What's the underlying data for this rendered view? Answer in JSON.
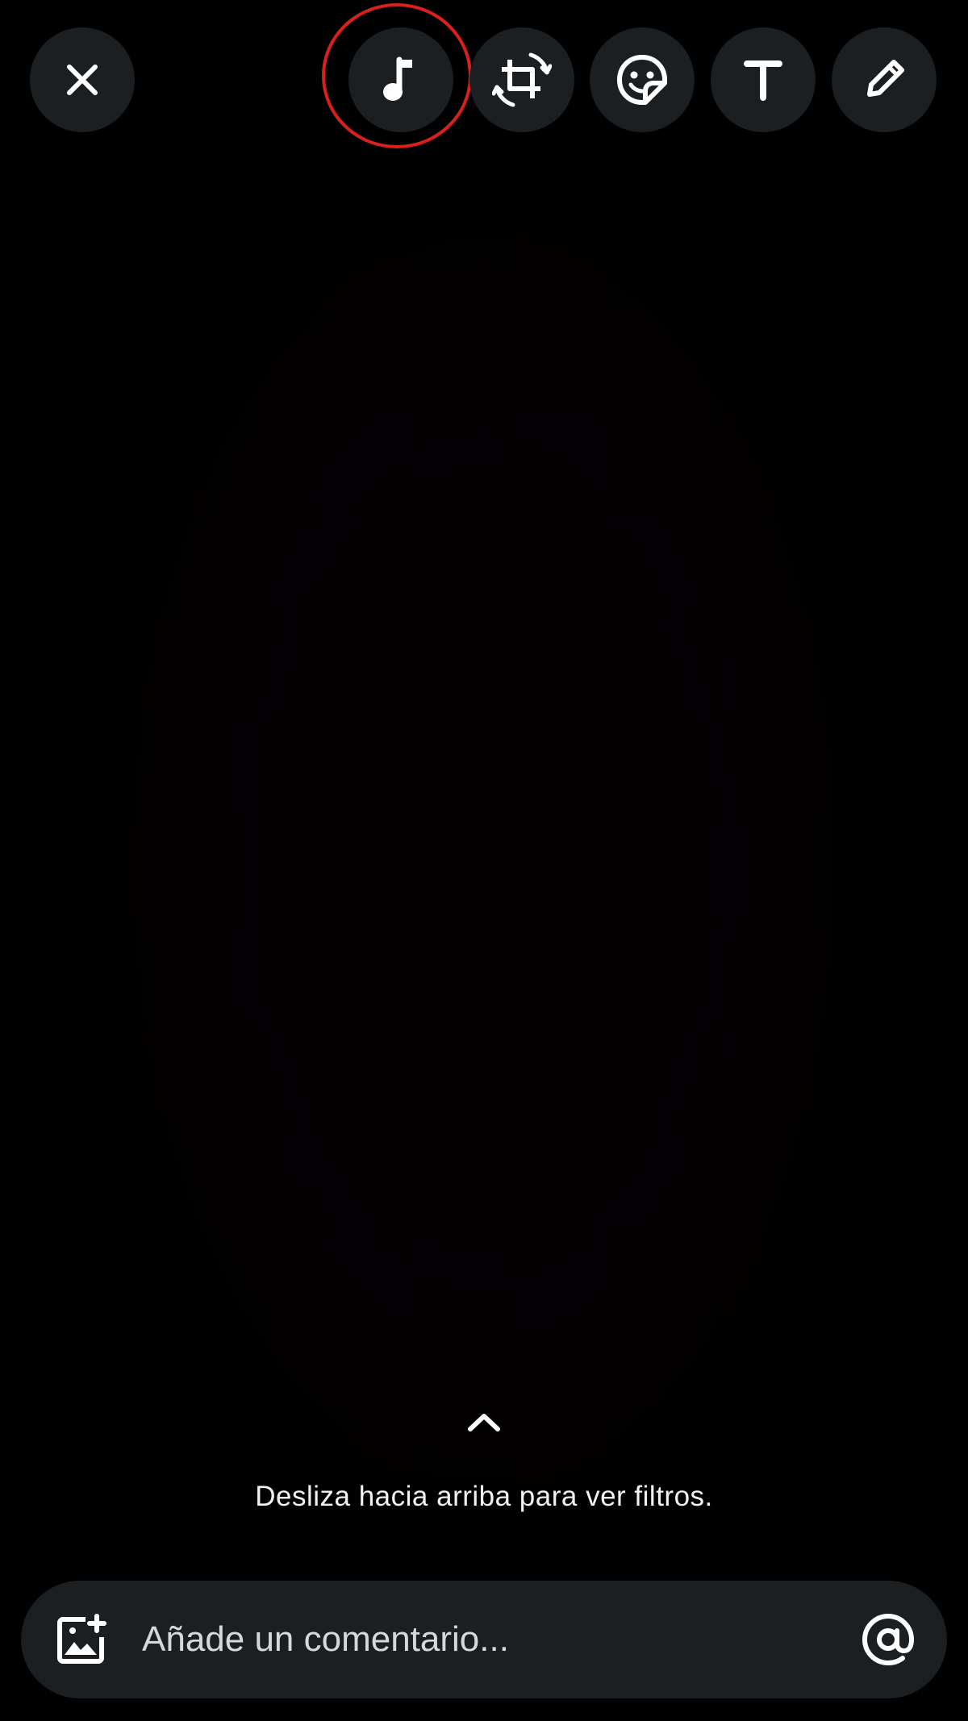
{
  "toolbar": {
    "close": {
      "icon": "close-icon"
    },
    "music": {
      "icon": "music-note-icon",
      "highlighted": true,
      "highlight_color": "#d9211c"
    },
    "crop_rotate": {
      "icon": "crop-rotate-icon"
    },
    "sticker": {
      "icon": "sticker-icon"
    },
    "text": {
      "icon": "text-icon"
    },
    "draw": {
      "icon": "pencil-icon"
    }
  },
  "filters_hint": {
    "icon": "chevron-up-icon",
    "text": "Desliza hacia arriba para ver filtros."
  },
  "comment_bar": {
    "gallery_icon": "add-image-icon",
    "placeholder": "Añade un comentario...",
    "value": "",
    "mention_icon": "at-sign-icon"
  },
  "colors": {
    "background": "#000000",
    "button_bg": "#1b1f22",
    "icon": "#ffffff",
    "highlight": "#d9211c"
  }
}
